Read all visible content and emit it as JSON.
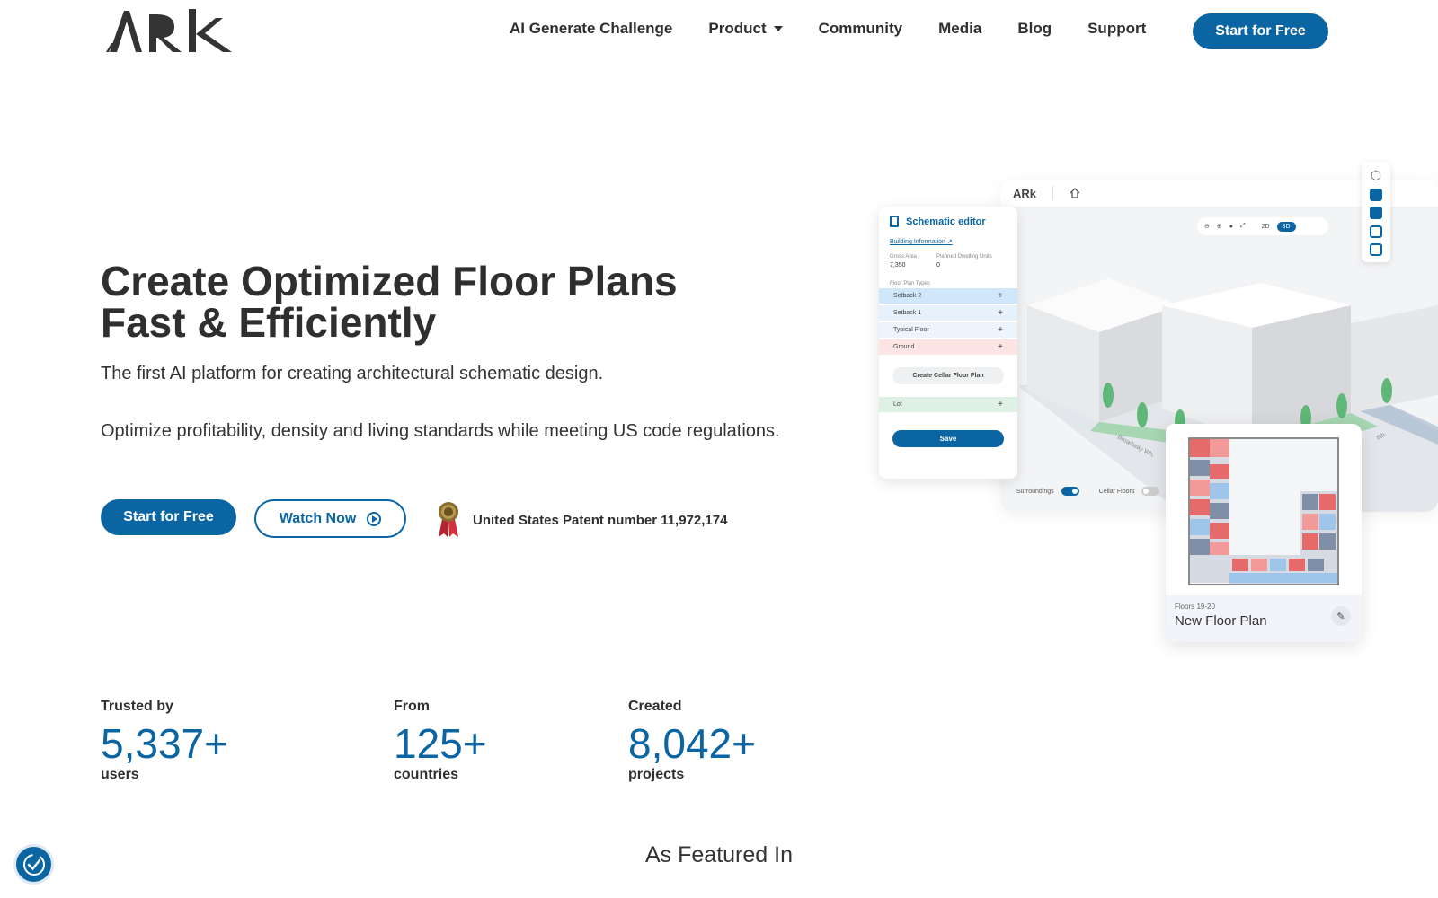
{
  "header": {
    "logo_text": "ARk",
    "nav": [
      "AI Generate Challenge",
      "Product",
      "Community",
      "Media",
      "Blog",
      "Support"
    ],
    "cta": "Start for Free"
  },
  "hero": {
    "title_line1": "Create Optimized Floor Plans",
    "title_line2": "Fast & Efficiently",
    "subtitle": "The first AI platform for creating architectural schematic design.",
    "description": "Optimize profitability, density and living standards while meeting US code regulations.",
    "start_label": "Start for Free",
    "watch_label": "Watch Now",
    "patent": "United States Patent number 11,972,174"
  },
  "mockup": {
    "app_logo": "ARk",
    "view_modes": [
      "2D",
      "3D"
    ],
    "panel_title": "Schematic editor",
    "building_info": "Building Information",
    "gross_area_label": "Gross Area",
    "gross_area_value": "7,350",
    "dwelling_label": "Planned Dwelling Units",
    "dwelling_value": "0",
    "types_label": "Floor Plan Types",
    "floor_types": [
      {
        "name": "Setback 2",
        "color": "#cfe6fb"
      },
      {
        "name": "Setback 1",
        "color": "#e6f1fb"
      },
      {
        "name": "Typical Floor",
        "color": "#eef4fb"
      },
      {
        "name": "Ground",
        "color": "#fde5e5"
      }
    ],
    "cellar_button": "Create Cellar Floor Plan",
    "lot_label": "Lot",
    "save_label": "Save",
    "surroundings_label": "Surroundings",
    "cellar_floors_label": "Cellar Floors",
    "street_label_1": "Broadway Wh.",
    "street_label_2": "8th",
    "plan_floors": "Floors 19-20",
    "plan_name": "New Floor Plan"
  },
  "stats": [
    {
      "label": "Trusted by",
      "value": "5,337+",
      "unit": "users"
    },
    {
      "label": "From",
      "value": "125+",
      "unit": "countries"
    },
    {
      "label": "Created",
      "value": "8,042+",
      "unit": "projects"
    }
  ],
  "featured": "As Featured In",
  "colors": {
    "brand": "#0b65a3",
    "text": "#2f2f2f"
  }
}
